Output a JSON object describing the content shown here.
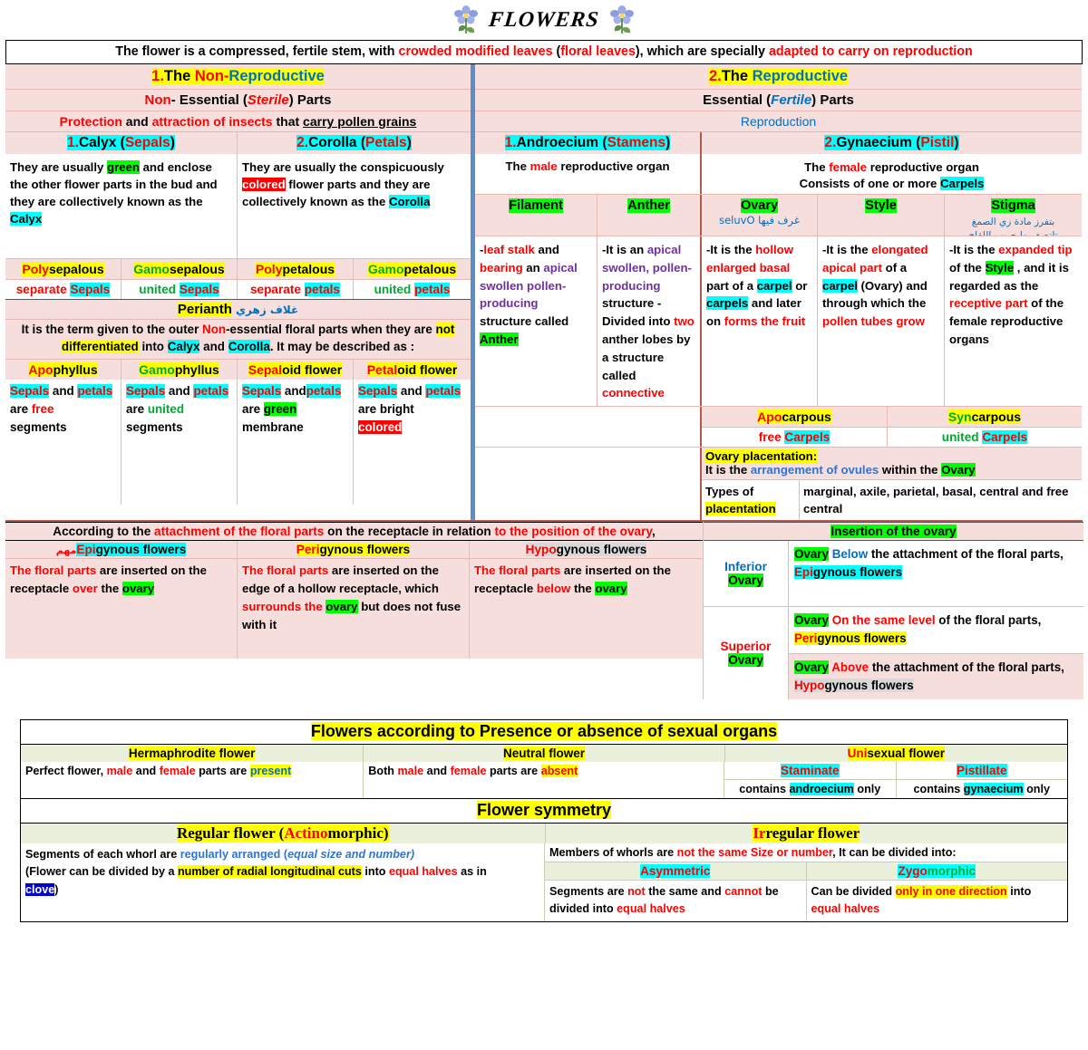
{
  "title": {
    "text": "FLOWERS",
    "icon_left": "flower-clipart",
    "icon_right": "flower-clipart"
  },
  "intro": {
    "p1": "The flower is a compressed, fertile stem, with ",
    "r1": "crowded modified leaves",
    "p2": " (",
    "r2": "floral leaves",
    "p3": "), which are specially ",
    "r3": "adapted to carry on reproduction"
  },
  "nonrepro": {
    "num": "1.",
    "word_non": "Non",
    "dash": "-",
    "word_repro": "Reproductive",
    "the": "The ",
    "sub_a": "Non",
    "sub_b": "- Essential (",
    "sub_c": "Sterile",
    "sub_d": ") Parts",
    "func_a": "Protection",
    "func_b": " and ",
    "func_c": "attraction of insects",
    "func_d": " that ",
    "func_e": "carry pollen grains"
  },
  "repro": {
    "num": "2.",
    "the": "The ",
    "word_repro": "Reproductive",
    "sub_a": "Essential (",
    "sub_b": "Fertile",
    "sub_c": ") Parts",
    "func": "Reproduction"
  },
  "calyx": {
    "num": "1.",
    "name": "Calyx",
    "open": " (",
    "paren": "Sepals",
    "close": ")",
    "desc_1": "They are usually ",
    "desc_green": "green",
    "desc_2": " and enclose the other flower parts in the bud and they are collectively known as the ",
    "desc_calyx": "Calyx"
  },
  "corolla": {
    "num": "2.",
    "name": "Corolla",
    "open": " (",
    "paren": "Petals",
    "close": ")",
    "desc_1": "They are usually the conspicuously ",
    "desc_colored": "colored",
    "desc_2": " flower parts and they are collectively known as the ",
    "desc_corolla": "Corolla"
  },
  "sepal_petal_types": [
    {
      "pre": "Poly",
      "post": "sepalous",
      "pre_color": "red",
      "sub_a": "separate ",
      "sub_b": "Sepals",
      "sub_a_color": "red"
    },
    {
      "pre": "Gamo",
      "post": "sepalous",
      "pre_color": "green",
      "sub_a": "united ",
      "sub_b": "Sepals",
      "sub_a_color": "green"
    },
    {
      "pre": "Poly",
      "post": "petalous",
      "pre_color": "red",
      "sub_a": "separate ",
      "sub_b": "petals",
      "sub_a_color": "red"
    },
    {
      "pre": "Gamo",
      "post": "petalous",
      "pre_color": "green",
      "sub_a": "united ",
      "sub_b": "petals",
      "sub_a_color": "green"
    }
  ],
  "perianth": {
    "label": "Perianth",
    "arabic": "غلاف زهري",
    "def_1": "It is the term given to the outer ",
    "def_non": "Non",
    "def_2": "-essential floral parts when they are ",
    "def_notdiff": "not differentiated",
    "def_3": " into ",
    "def_calyx": "Calyx",
    "def_4": " and ",
    "def_corolla": "Corolla",
    "def_5": ". It may be described as :"
  },
  "phyllus_types": [
    {
      "pre": "Apo",
      "post": "phyllus",
      "pre_color": "red",
      "l1_a": "Sepals",
      "l1_b": " and ",
      "l1_c": "petals",
      "l2_a": "are ",
      "l2_b": "free",
      "l2_style": "red",
      "l3": "segments"
    },
    {
      "pre": "Gamo",
      "post": "phyllus",
      "pre_color": "green",
      "l1_a": "Sepals",
      "l1_b": " and ",
      "l1_c": "petals",
      "l2_a": "are ",
      "l2_b": "united",
      "l2_style": "green",
      "l3": "segments"
    },
    {
      "pre": "Sepal",
      "post": "oid flower",
      "pre_color": "red",
      "l1_a": "Sepals",
      "l1_b": " and",
      "l1_c": "petals",
      "l2_a": "are ",
      "l2_b": "green",
      "l2_style": "hl-green",
      "l3": "membrane"
    },
    {
      "pre": "Petal",
      "post": "oid flower",
      "pre_color": "red",
      "l1_a": "Sepals",
      "l1_b": " and ",
      "l1_c": "petals",
      "l2_a": "are bright",
      "l2_b": "colored",
      "l2_style": "hl-red",
      "l3": ""
    }
  ],
  "androecium": {
    "num": "1.",
    "name": "Androecium",
    "open": " (",
    "paren": "Stamens",
    "close": ")",
    "desc_a": "The ",
    "desc_male": "male",
    "desc_b": " reproductive organ",
    "filament": {
      "title": "Filament",
      "l1_a": "-",
      "l1_b": "leaf stalk",
      "l1_c": " and ",
      "l2_a": "bearing",
      "l2_b": " an ",
      "l2_c": "apical",
      "l3": "swollen",
      "l4": "pollen-producing",
      "l5": "structure called",
      "l6": "Anther"
    },
    "anther": {
      "title": "Anther",
      "l1": "-It is an",
      "l2": "apical swollen,",
      "l3": "pollen-producing",
      "l4": "structure",
      "l5_a": "-Divided into",
      "l6_a": "two",
      "l6_b": " anther",
      "l7": "lobes by a",
      "l8": "structure called",
      "l9": "connective"
    }
  },
  "gynaecium": {
    "num": "2.",
    "name": "Gynaecium",
    "open": " (",
    "paren": "Pistil",
    "close": ")",
    "desc_a": "The ",
    "desc_female": "female",
    "desc_b": " reproductive organ",
    "desc_c": "Consists of one or more ",
    "desc_carpels": "Carpels",
    "ovary": {
      "title": "Ovary",
      "arabic": "غرف فيها Ovules",
      "l1_a": "-It is the ",
      "l1_b": "hollow",
      "l2": "enlarged basal",
      "l3_a": "part of a ",
      "l3_b": "carpel",
      "l4_a": "or ",
      "l4_b": "carpels",
      "l4_c": " and",
      "l5_a": "later on ",
      "l5_b": "forms",
      "l6": "the fruit"
    },
    "style": {
      "title": "Style",
      "l1_a": "-It is the ",
      "l1_b": "elongated",
      "l2_a": "apical part",
      "l2_b": " of a",
      "l3_a": "carpel",
      "l3_b": " (Ovary) and",
      "l4": "through which the",
      "l5": "pollen tubes grow"
    },
    "stigma": {
      "title": "Stigma",
      "arabic_1": "بتفرز مادة زي الصمغ",
      "arabic_2": "تلتصق بها حبوب اللقاح",
      "l1_a": "-It is the ",
      "l1_b": "expanded",
      "l2_a": "tip",
      "l2_b": " of the ",
      "l2_c": "Style",
      "l3": ", and it is regarded",
      "l4_a": "as the ",
      "l4_b": "receptive",
      "l5_a": "part",
      "l5_b": " of the female",
      "l6": "reproductive",
      "l7": "organs"
    }
  },
  "carpel_types": [
    {
      "pre": "Apo",
      "post": "carpous",
      "pre_color": "red",
      "sub_a": "free ",
      "sub_b": "Carpels",
      "sub_a_color": "red"
    },
    {
      "pre": "Syn",
      "post": "carpous",
      "pre_color": "green",
      "sub_a": "united ",
      "sub_b": "Carpels",
      "sub_a_color": "green"
    }
  ],
  "placentation": {
    "label": "Ovary placentation:",
    "def_a": "It is the ",
    "def_b": "arrangement of ovules",
    "def_c": " within the ",
    "def_d": "Ovary",
    "types_label_1": "Types of",
    "types_label_2": "placentation",
    "types_value": "marginal, axile, parietal, basal, central and free central"
  },
  "attachment": {
    "head_a": "According to the ",
    "head_b": "attachment of the floral parts",
    "head_c": " on the receptacle in relation ",
    "head_d": "to the position of the ovary",
    "head_e": ",",
    "cols": [
      {
        "arabic": "مهم",
        "pre": "Epi",
        "post": "gynous flowers",
        "hl": "cyan",
        "d1": "The floral parts",
        "d2": " are inserted on the receptacle ",
        "d3": "over",
        "d4": " the ",
        "d5": "ovary"
      },
      {
        "arabic": "",
        "pre": "Peri",
        "post": "gynous flowers",
        "hl": "yellow",
        "d1": "The floral parts",
        "d2": " are inserted on the edge of a hollow receptacle, which ",
        "d3": "surrounds the",
        "d4": " ",
        "d5": "ovary",
        "d6": " but does not fuse with it"
      },
      {
        "arabic": "",
        "pre": "Hypo",
        "post": "gynous flowers",
        "hl": "grey",
        "d1": "The floral parts",
        "d2": " are inserted on the receptacle ",
        "d3": "below",
        "d4": " the ",
        "d5": "ovary"
      }
    ]
  },
  "insertion": {
    "title": "Insertion of the ovary",
    "rows": [
      {
        "label_1": "Inferior",
        "label_2": "Ovary",
        "label_color": "blue",
        "blocks": [
          {
            "a": "Ovary",
            "b": " Below",
            "b_color": "blue",
            "c": " the attachment of the floral parts,",
            "d_pre": "Epi",
            "d_post": "gynous flowers",
            "d_hl": "cyan"
          }
        ]
      },
      {
        "label_1": "Superior",
        "label_2": "Ovary",
        "label_color": "red",
        "blocks": [
          {
            "a": "Ovary",
            "b": " On the same level",
            "b_color": "red",
            "c": " of the floral parts,",
            "d_pre": "Peri",
            "d_post": "gynous flowers",
            "d_hl": "yellow"
          },
          {
            "a": "Ovary",
            "b": " Above",
            "b_color": "red",
            "c": " the attachment of the floral parts,",
            "d_pre": "Hypo",
            "d_post": "gynous flowers",
            "d_hl": "grey"
          }
        ]
      }
    ]
  },
  "sexual_table": {
    "title": "Flowers according to Presence or absence of sexual organs",
    "headers": [
      "Hermaphrodite flower",
      "Neutral flower"
    ],
    "uni_pre": "Uni",
    "uni_post": "sexual flower",
    "herm_a": "Perfect flower, ",
    "herm_b": "male",
    "herm_c": " and ",
    "herm_d": "female",
    "herm_e": " parts are ",
    "herm_f": "present",
    "neut_a": "Both ",
    "neut_b": "male",
    "neut_c": " and ",
    "neut_d": "female",
    "neut_e": " parts are ",
    "neut_f": "absent",
    "staminate": "Staminate",
    "pistillate": "Pistillate",
    "staminate_desc_a": "contains ",
    "staminate_desc_b": "androecium",
    "staminate_desc_c": " only",
    "pistillate_desc_a": "contains ",
    "pistillate_desc_b": "gynaecium",
    "pistillate_desc_c": " only"
  },
  "symmetry_table": {
    "title": "Flower symmetry",
    "regular_a": "Regular flower (",
    "regular_b": "Actino",
    "regular_c": "morphic)",
    "irregular_a": "Ir",
    "irregular_b": "regular flower",
    "reg_l1_a": "Segments of each whorl are ",
    "reg_l1_b": "regularly arranged (",
    "reg_l1_c": "equal size and number)",
    "reg_l2_a": "(Flower can be divided by a ",
    "reg_l2_b": "number of radial longitudinal cuts",
    "reg_l2_c": " into ",
    "reg_l2_d": "equal halves",
    "reg_l2_e": " as in ",
    "reg_l3_a": "clove",
    "reg_l3_b": ")",
    "irr_l1_a": "Members of whorls are ",
    "irr_l1_b": "not the same Size or number",
    "irr_l1_c": ", It can be divided into:",
    "asym": "Asymmetric",
    "zygo_pre": "Zygo",
    "zygo_post": "morphic",
    "asym_a": "Segments are ",
    "asym_b": "not",
    "asym_c": " the same and ",
    "asym_d": "cannot",
    "asym_e": " be divided into ",
    "asym_f": "equal halves",
    "zygo_a": "Can be divided ",
    "zygo_b": "only in one direction",
    "zygo_c": " into ",
    "zygo_d": "equal halves"
  }
}
